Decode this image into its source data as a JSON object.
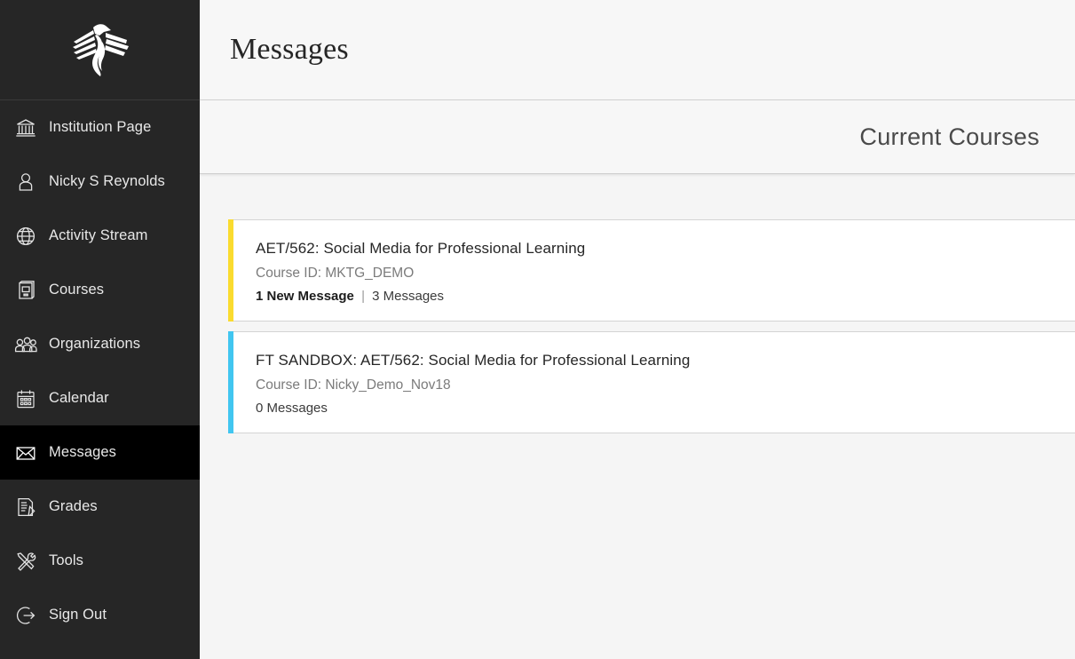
{
  "sidebar": {
    "logo_name": "phoenix-logo",
    "bg_color": "#262626",
    "active_bg_color": "#000000",
    "items": [
      {
        "label": "Institution Page",
        "icon": "bank-icon",
        "active": false
      },
      {
        "label": "Nicky S Reynolds",
        "icon": "user-icon",
        "active": false
      },
      {
        "label": "Activity Stream",
        "icon": "globe-icon",
        "active": false
      },
      {
        "label": "Courses",
        "icon": "book-icon",
        "active": false
      },
      {
        "label": "Organizations",
        "icon": "people-group-icon",
        "active": false
      },
      {
        "label": "Calendar",
        "icon": "calendar-icon",
        "active": false
      },
      {
        "label": "Messages",
        "icon": "envelope-icon",
        "active": true
      },
      {
        "label": "Grades",
        "icon": "document-pencil-icon",
        "active": false
      },
      {
        "label": "Tools",
        "icon": "wrench-screwdriver-icon",
        "active": false
      },
      {
        "label": "Sign Out",
        "icon": "sign-out-arrow-icon",
        "active": false
      }
    ]
  },
  "header": {
    "title": "Messages"
  },
  "subheader": {
    "title": "Current Courses"
  },
  "courses": [
    {
      "title": "AET/562: Social Media for Professional Learning",
      "course_id_label": "Course ID: MKTG_DEMO",
      "new_messages": "1 New Message",
      "separator": "|",
      "total_messages": "3 Messages",
      "accent_color": "#fadb2f"
    },
    {
      "title": "FT SANDBOX: AET/562: Social Media for Professional Learning",
      "course_id_label": "Course ID: Nicky_Demo_Nov18",
      "new_messages": "",
      "separator": "",
      "total_messages": "0 Messages",
      "accent_color": "#41c6f0"
    }
  ]
}
